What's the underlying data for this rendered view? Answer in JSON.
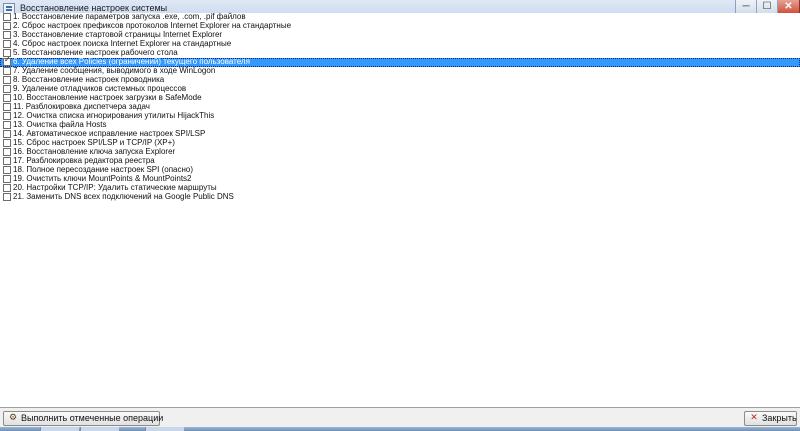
{
  "window": {
    "title": "Восстановление настроек системы",
    "controls": {
      "minimize": "─",
      "maximize": "☐",
      "close": "✕"
    }
  },
  "items": [
    {
      "label": "1. Восстановление параметров запуска .exe, .com, .pif файлов",
      "checked": false,
      "selected": false
    },
    {
      "label": "2. Сброс настроек префиксов протоколов Internet Explorer на стандартные",
      "checked": false,
      "selected": false
    },
    {
      "label": "3. Восстановление стартовой страницы Internet Explorer",
      "checked": false,
      "selected": false
    },
    {
      "label": "4. Сброс настроек поиска Internet Explorer на стандартные",
      "checked": false,
      "selected": false
    },
    {
      "label": "5. Восстановление настроек рабочего стола",
      "checked": false,
      "selected": false
    },
    {
      "label": "6. Удаление всех Policies (ограничений) текущего пользователя",
      "checked": true,
      "selected": true
    },
    {
      "label": "7. Удаление сообщения, выводимого в ходе WinLogon",
      "checked": false,
      "selected": false
    },
    {
      "label": "8. Восстановление настроек проводника",
      "checked": false,
      "selected": false
    },
    {
      "label": "9. Удаление отладчиков системных процессов",
      "checked": false,
      "selected": false
    },
    {
      "label": "10. Восстановление настроек загрузки в SafeMode",
      "checked": false,
      "selected": false
    },
    {
      "label": "11. Разблокировка диспетчера задач",
      "checked": false,
      "selected": false
    },
    {
      "label": "12. Очистка списка игнорирования утилиты HijackThis",
      "checked": false,
      "selected": false
    },
    {
      "label": "13. Очистка файла Hosts",
      "checked": false,
      "selected": false
    },
    {
      "label": "14. Автоматическое исправление настроек SPI/LSP",
      "checked": false,
      "selected": false
    },
    {
      "label": "15. Сброс настроек SPI/LSP и TCP/IP (XP+)",
      "checked": false,
      "selected": false
    },
    {
      "label": "16. Восстановление ключа запуска Explorer",
      "checked": false,
      "selected": false
    },
    {
      "label": "17. Разблокировка редактора реестра",
      "checked": false,
      "selected": false
    },
    {
      "label": "18. Полное пересоздание настроек SPI (опасно)",
      "checked": false,
      "selected": false
    },
    {
      "label": "19. Очистить ключи MountPoints & MountPoints2",
      "checked": false,
      "selected": false
    },
    {
      "label": "20. Настройки TCP/IP: Удалить статические маршруты",
      "checked": false,
      "selected": false
    },
    {
      "label": "21. Заменить DNS всех подключений на Google Public DNS",
      "checked": false,
      "selected": false
    }
  ],
  "buttons": {
    "run": {
      "label": "Выполнить отмеченные операции",
      "icon": "run-operations-icon"
    },
    "close": {
      "label": "Закрыть",
      "icon": "close-x-icon"
    }
  },
  "colors": {
    "selection": "#3399ff",
    "close_icon": "#c0281a"
  }
}
